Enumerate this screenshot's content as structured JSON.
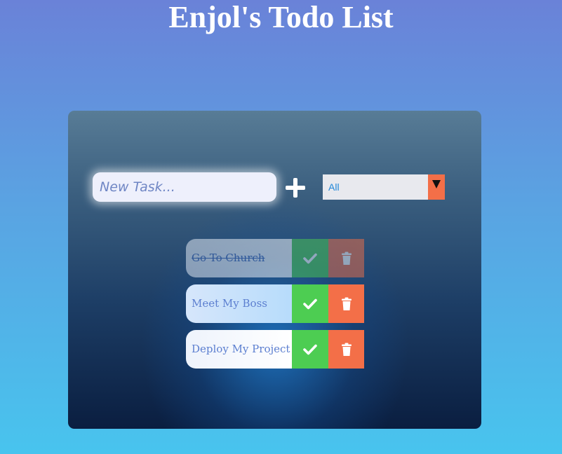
{
  "header": {
    "title": "Enjol's Todo List"
  },
  "form": {
    "input_placeholder": "New Task...",
    "add_icon": "plus-icon",
    "filter": {
      "selected": "All"
    }
  },
  "todos": [
    {
      "text": "Go To Church",
      "completed": true,
      "check_icon": "check-icon",
      "delete_icon": "trash-icon"
    },
    {
      "text": "Meet My Boss",
      "completed": false,
      "check_icon": "check-icon",
      "delete_icon": "trash-icon"
    },
    {
      "text": "Deploy My Project",
      "completed": false,
      "check_icon": "check-icon",
      "delete_icon": "trash-icon"
    }
  ],
  "colors": {
    "check": "#4dcd52",
    "delete": "#f36f48",
    "filter_arrow_bg": "#f36f48",
    "accent_text": "#5c7fd0"
  }
}
